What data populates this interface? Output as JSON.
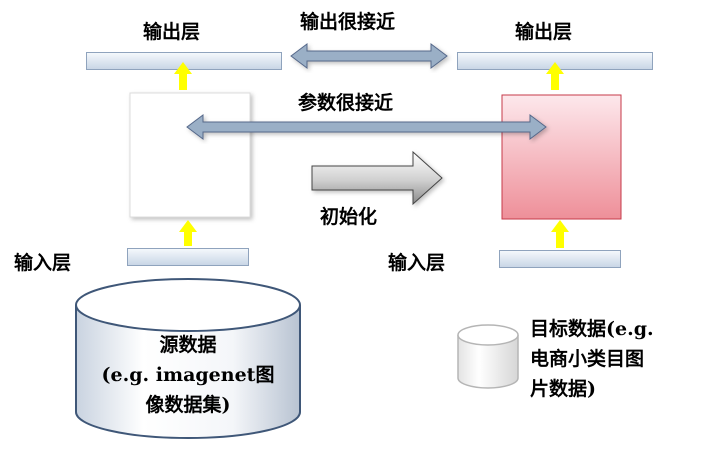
{
  "left_model": {
    "output_layer_label": "输出层",
    "input_layer_label": "输入层"
  },
  "right_model": {
    "output_layer_label": "输出层",
    "input_layer_label": "输入层"
  },
  "relations": {
    "output_close_label": "输出很接近",
    "params_close_label": "参数很接近",
    "init_label": "初始化"
  },
  "source_data": {
    "line1": "源数据",
    "line2": "(e.g. imagenet图",
    "line3": "像数据集)"
  },
  "target_data": {
    "line1": "目标数据(e.g.",
    "line2": "电商小类目图",
    "line3": "片数据)"
  },
  "colors": {
    "arrow_yellow": "#ffff00",
    "double_arrow": "#8ea3bb",
    "pink_block_top": "#fde8ec",
    "pink_block_bottom": "#ee8f99",
    "layer_bar_top": "#f4f8fc",
    "layer_bar_bottom": "#c9d6e6"
  }
}
